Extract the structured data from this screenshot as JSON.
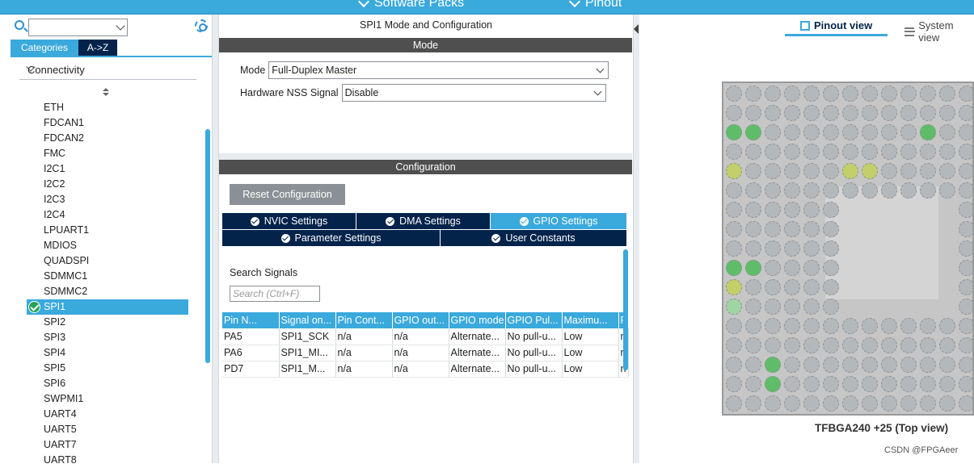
{
  "topbar": {
    "software_packs": "Software Packs",
    "pinout": "Pinout"
  },
  "left": {
    "search_value": "",
    "tabs": {
      "categories": "Categories",
      "az": "A->Z"
    },
    "group": "Connectivity",
    "peripherals": [
      "ETH",
      "FDCAN1",
      "FDCAN2",
      "FMC",
      "I2C1",
      "I2C2",
      "I2C3",
      "I2C4",
      "LPUART1",
      "MDIOS",
      "QUADSPI",
      "SDMMC1",
      "SDMMC2",
      "SPI1",
      "SPI2",
      "SPI3",
      "SPI4",
      "SPI5",
      "SPI6",
      "SWPMI1",
      "UART4",
      "UART5",
      "UART7",
      "UART8"
    ],
    "selected": "SPI1"
  },
  "mid": {
    "title": "SPI1 Mode and Configuration",
    "mode_header": "Mode",
    "mode_label": "Mode",
    "mode_value": "Full-Duplex Master",
    "nss_label": "Hardware NSS Signal",
    "nss_value": "Disable",
    "config_header": "Configuration",
    "reset_button": "Reset Configuration",
    "tabs_row1": [
      "NVIC Settings",
      "DMA Settings",
      "GPIO Settings"
    ],
    "tabs_row2": [
      "Parameter Settings",
      "User Constants"
    ],
    "active_tab": "GPIO Settings",
    "search_signals_label": "Search Signals",
    "search_placeholder": "Search (Ctrl+F)",
    "table": {
      "headers": [
        "Pin N...",
        "Signal on...",
        "Pin Cont...",
        "GPIO out...",
        "GPIO mode",
        "GPIO Pul...",
        "Maximu...",
        "F"
      ],
      "rows": [
        [
          "PA5",
          "SPI1_SCK",
          "n/a",
          "n/a",
          "Alternate...",
          "No pull-u...",
          "Low",
          "n"
        ],
        [
          "PA6",
          "SPI1_MI...",
          "n/a",
          "n/a",
          "Alternate...",
          "No pull-u...",
          "Low",
          "n"
        ],
        [
          "PD7",
          "SPI1_M...",
          "n/a",
          "n/a",
          "Alternate...",
          "No pull-u...",
          "Low",
          "n"
        ]
      ]
    }
  },
  "right": {
    "pinout_view": "Pinout view",
    "system_view": "System view",
    "chip_label": "TFBGA240 +25 (Top view)",
    "watermark": "CSDN @FPGAeer",
    "colors": {
      "pin_default": "#b5b8bb",
      "pin_green": "#5fbd6a",
      "pin_yellow": "#c2cf6a",
      "pin_lightgreen": "#9fd4a3"
    }
  }
}
